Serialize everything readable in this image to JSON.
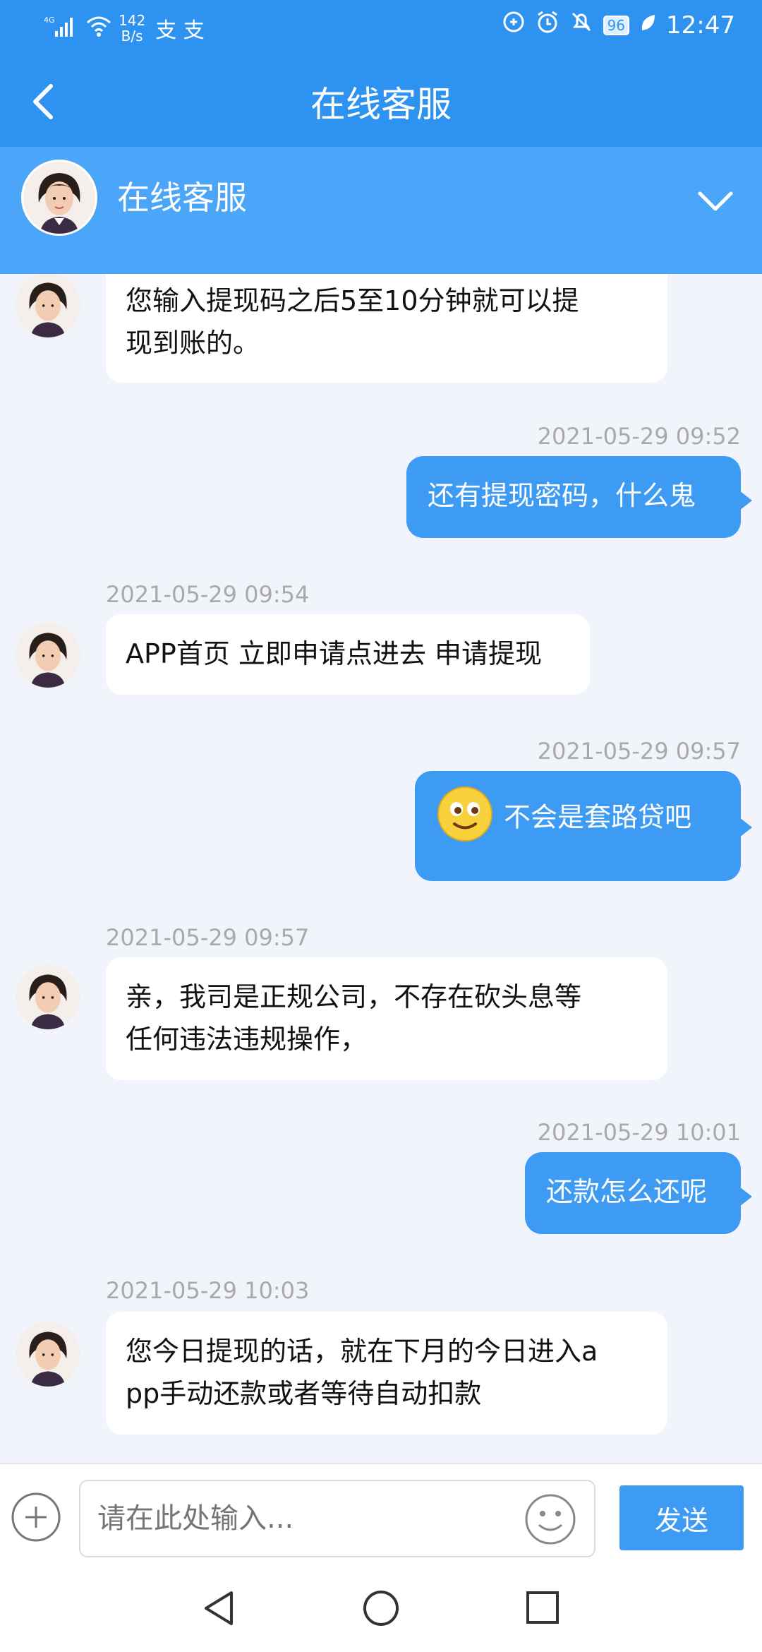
{
  "status_bar": {
    "network_type": "4G",
    "speed_value": "142",
    "speed_unit": "B/s",
    "app_icons": "支 支",
    "battery": "96",
    "time": "12:47"
  },
  "header": {
    "title": "在线客服"
  },
  "agent": {
    "name": "在线客服"
  },
  "messages": [
    {
      "side": "left",
      "time": "",
      "text_lines": [
        "您输入提现码之后5至10分钟就可以提",
        "现到账的。"
      ]
    },
    {
      "side": "right",
      "time": "2021-05-29 09:52",
      "text_lines": [
        "还有提现密码，什么鬼"
      ]
    },
    {
      "side": "left",
      "time": "2021-05-29 09:54",
      "text_lines": [
        "APP首页 立即申请点进去  申请提现"
      ]
    },
    {
      "side": "right",
      "time": "2021-05-29 09:57",
      "text_lines": [
        "不会是套路贷吧"
      ],
      "emoji": "smiley-emoji"
    },
    {
      "side": "left",
      "time": "2021-05-29 09:57",
      "text_lines": [
        "亲，我司是正规公司，不存在砍头息等",
        "任何违法违规操作，"
      ]
    },
    {
      "side": "right",
      "time": "2021-05-29 10:01",
      "text_lines": [
        "还款怎么还呢"
      ]
    },
    {
      "side": "left",
      "time": "2021-05-29 10:03",
      "text_lines": [
        "您今日提现的话，就在下月的今日进入a",
        "pp手动还款或者等待自动扣款"
      ]
    }
  ],
  "input": {
    "placeholder": "请在此处输入...",
    "send_label": "发送"
  },
  "colors": {
    "primary": "#2e93f0",
    "header_light": "#4ba5f8",
    "bubble_right": "#3d9bf3",
    "background": "#f1f5fb"
  },
  "icons": {
    "back": "back-chevron-icon",
    "expand": "chevron-down-icon",
    "add": "plus-circle-icon",
    "emoji": "smiley-face-icon",
    "nav_back": "triangle-back-icon",
    "nav_home": "circle-home-icon",
    "nav_recent": "square-recent-icon"
  }
}
